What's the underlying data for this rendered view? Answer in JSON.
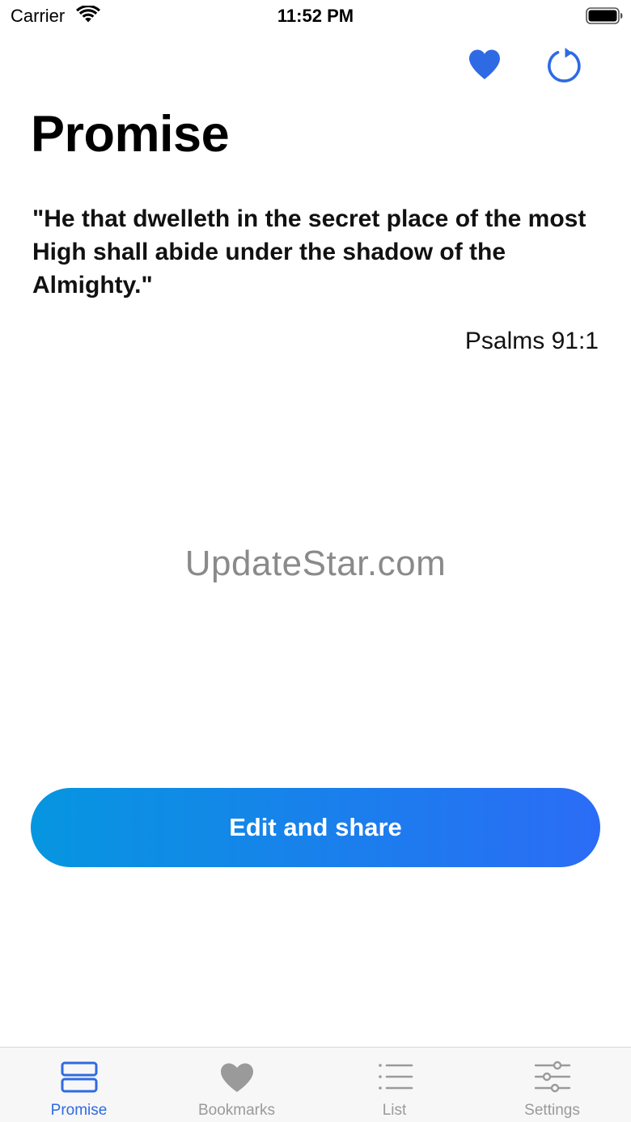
{
  "status_bar": {
    "carrier": "Carrier",
    "time": "11:52 PM"
  },
  "header": {
    "title": "Promise",
    "actions": [
      {
        "name": "bookmark",
        "icon": "heart-filled-icon",
        "color": "#2f6ae5"
      },
      {
        "name": "refresh",
        "icon": "refresh-icon",
        "color": "#2f6ae5"
      }
    ]
  },
  "verse": {
    "text": "\"He that dwelleth in the secret place of the most High shall abide under the shadow of the Almighty.\"",
    "reference": "Psalms 91:1"
  },
  "watermark": "UpdateStar.com",
  "edit_share": {
    "label": "Edit and share",
    "gradient_start": "#0696e0",
    "gradient_end": "#2b6cf6"
  },
  "tab_bar": {
    "active_color": "#2f6ae5",
    "inactive_color": "#9a9a9a",
    "tabs": [
      {
        "label": "Promise",
        "icon": "cards-icon",
        "active": true
      },
      {
        "label": "Bookmarks",
        "icon": "heart-icon",
        "active": false
      },
      {
        "label": "List",
        "icon": "list-icon",
        "active": false
      },
      {
        "label": "Settings",
        "icon": "sliders-icon",
        "active": false
      }
    ]
  }
}
